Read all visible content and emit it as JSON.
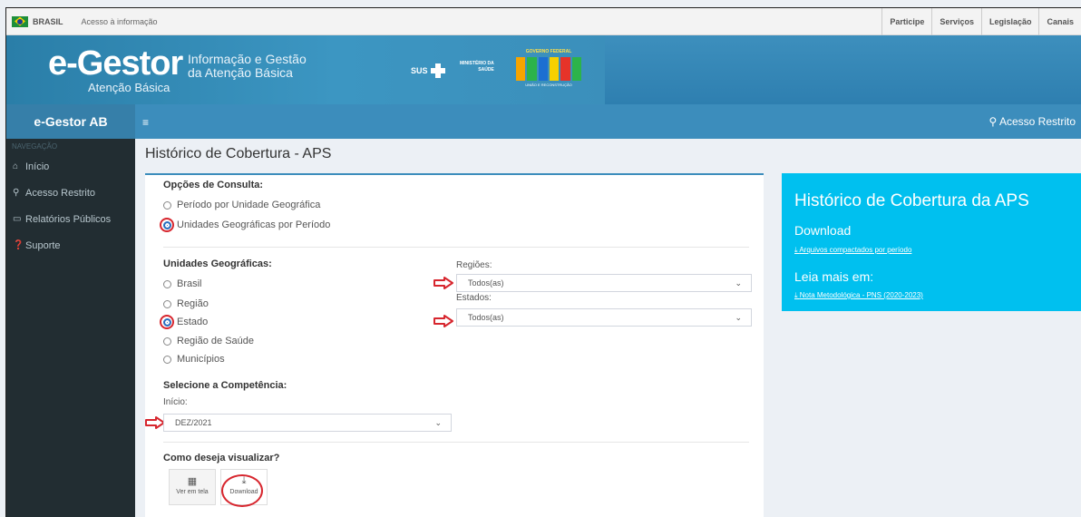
{
  "govbar": {
    "brasil": "BRASIL",
    "acesso_info": "Acesso à informação",
    "links": [
      "Participe",
      "Serviços",
      "Legislação",
      "Canais"
    ]
  },
  "banner": {
    "logo": "e-Gestor",
    "logo_sub": "Atenção Básica",
    "tagline_1": "Informação e Gestão",
    "tagline_2": "da Atenção Básica",
    "sus": "SUS",
    "ministerio_1": "MINISTÉRIO DA",
    "ministerio_2": "SAÚDE",
    "gov_federal": "GOVERNO FEDERAL",
    "uniao": "UNIÃO E RECONSTRUÇÃO"
  },
  "navbar": {
    "brand": "e-Gestor AB",
    "menu_icon": "≡",
    "acesso_restrito": "Acesso Restrito"
  },
  "sidebar": {
    "header": "NAVEGAÇÃO",
    "items": [
      {
        "icon": "home-icon",
        "label": "Início"
      },
      {
        "icon": "key-icon",
        "label": "Acesso Restrito"
      },
      {
        "icon": "monitor-icon",
        "label": "Relatórios Públicos"
      },
      {
        "icon": "question-icon",
        "label": "Suporte"
      }
    ]
  },
  "page": {
    "title": "Histórico de Cobertura - APS"
  },
  "form": {
    "opcoes_label": "Opções de Consulta:",
    "opcao_1": "Período por Unidade Geográfica",
    "opcao_2": "Unidades Geográficas por Período",
    "unidades_label": "Unidades Geográficas:",
    "unidades": [
      "Brasil",
      "Região",
      "Estado",
      "Região de Saúde",
      "Municípios"
    ],
    "selected_unidade": "Estado",
    "regioes_label": "Regiões:",
    "regioes_value": "Todos(as)",
    "estados_label": "Estados:",
    "estados_value": "Todos(as)",
    "competencia_label": "Selecione a Competência:",
    "inicio_label": "Início:",
    "inicio_value": "DEZ/2021",
    "visualizar_label": "Como deseja visualizar?",
    "ver_em_tela": "Ver em tela",
    "download": "Download"
  },
  "info_panel": {
    "title": "Histórico de Cobertura da APS",
    "download_heading": "Download",
    "link_1": "Arquivos compactados por período",
    "leia_heading": "Leia mais em:",
    "link_2": "Nota Metodológica - PNS (2020-2023)"
  },
  "colors": {
    "navbar": "#3c8dbc",
    "sidebar": "#222d32",
    "info": "#00c0ef",
    "highlight": "#d7262e"
  }
}
